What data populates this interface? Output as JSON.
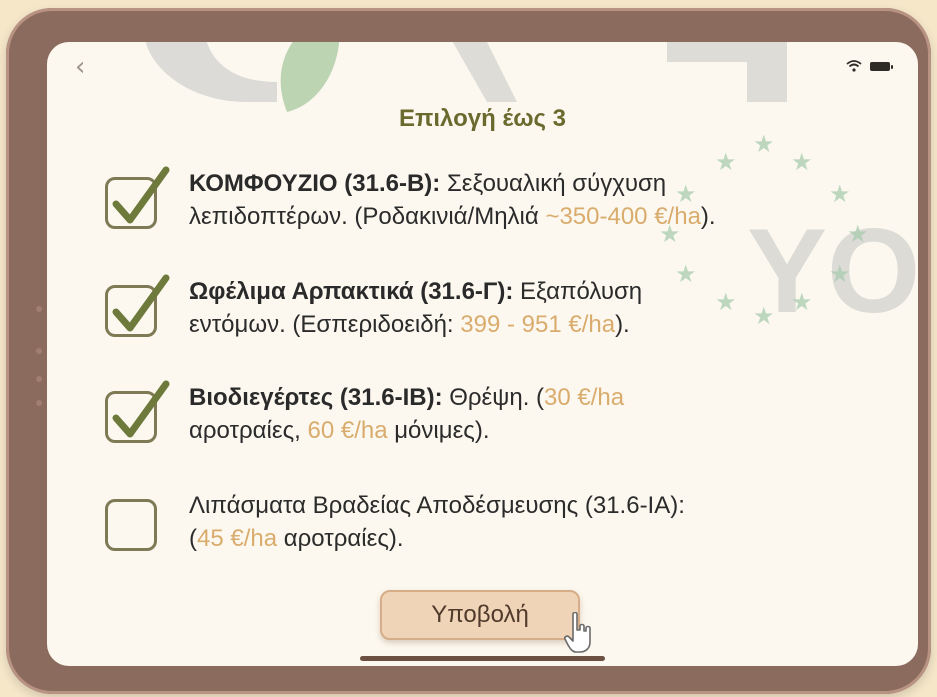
{
  "nav": {
    "back_icon": "‹"
  },
  "status": {
    "wifi_icon": "wifi-icon",
    "battery_icon": "battery-icon"
  },
  "title": "Επιλογή έως 3",
  "options": [
    {
      "checked": true,
      "bold": "ΚΟΜΦΟΥΖΙΟ (31.6-Β):",
      "line1": " Σεξουαλική σύγχυση",
      "line2_pre": "λεπιδοπτέρων. (Ροδακινιά/Μηλιά ",
      "price": "~350-400 €/ha",
      "line2_post": ")."
    },
    {
      "checked": true,
      "bold": "Ωφέλιμα Αρπακτικά (31.6-Γ):",
      "line1": " Εξαπόλυση",
      "line2_pre": "εντόμων. (Εσπεριδοειδή: ",
      "price": "399 - 951 €/ha",
      "line2_post": ")."
    },
    {
      "checked": true,
      "bold": "Βιοδιεγέρτες (31.6-ΙΒ):",
      "line1": " Θρέψη. (",
      "price1": "30 €/ha",
      "line2_pre": "αροτραίες, ",
      "price2": "60 €/ha",
      "line2_post": " μόνιμες)."
    },
    {
      "checked": false,
      "line1": "Λιπάσματα Βραδείας Αποδέσμευσης (31.6-ΙΑ):",
      "line2_open": "(",
      "price": "45 €/ha",
      "line2_post": " αροτραίες)."
    }
  ],
  "submit_label": "Υποβολή",
  "colors": {
    "accent_title": "#6b6a2e",
    "price": "#d9ac6d",
    "check": "#6e7a3c",
    "bezel": "#8a6b5d"
  }
}
